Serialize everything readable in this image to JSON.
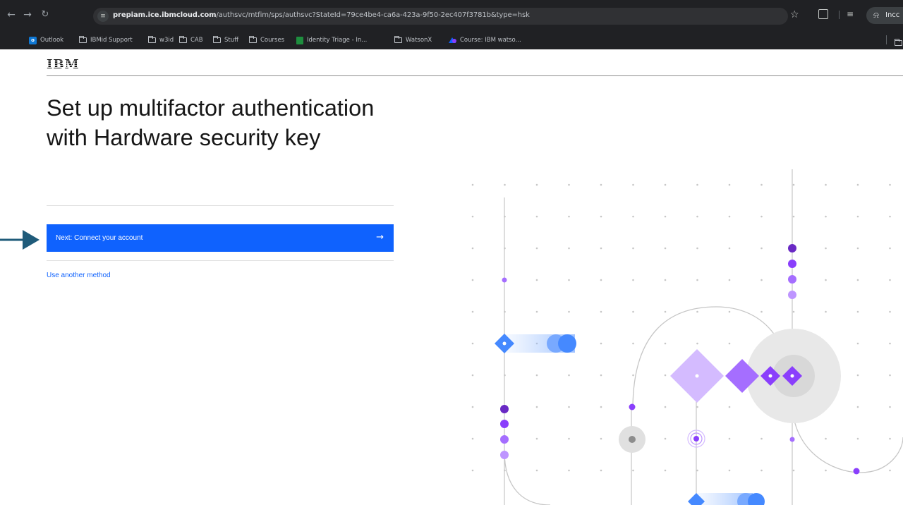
{
  "browser": {
    "url_host": "prepiam.ice.ibmcloud.com",
    "url_path": "/authsvc/mtfim/sps/authsvc?StateId=79ce4be4-ca6a-423a-9f50-2ec407f3781b&type=hsk",
    "profile_label": "Incc",
    "bookmarks": [
      {
        "label": "Outlook",
        "icon": "outlook-icon"
      },
      {
        "label": "IBMid Support",
        "icon": "folder-icon"
      },
      {
        "label": "w3id",
        "icon": "folder-icon"
      },
      {
        "label": "CAB",
        "icon": "folder-icon"
      },
      {
        "label": "Stuff",
        "icon": "folder-icon"
      },
      {
        "label": "Courses",
        "icon": "folder-icon"
      },
      {
        "label": "Identity Triage - In...",
        "icon": "sheet-icon"
      },
      {
        "label": "WatsonX",
        "icon": "folder-icon"
      },
      {
        "label": "Course: IBM watso...",
        "icon": "course-icon"
      }
    ]
  },
  "page": {
    "logo": "IBM",
    "title": "Set up multifactor authentication with Hardware security key",
    "primary_button": "Next: Connect your account",
    "primary_button_arrow": "→",
    "alt_link": "Use another method"
  },
  "colors": {
    "primary": "#0f62fe",
    "annotation_arrow": "#1f5b7a",
    "purple": "#8a3ffc",
    "light_purple": "#be95ff",
    "dark_purple": "#6929c4",
    "blue": "#4589ff",
    "light_blue": "#78a9ff"
  }
}
